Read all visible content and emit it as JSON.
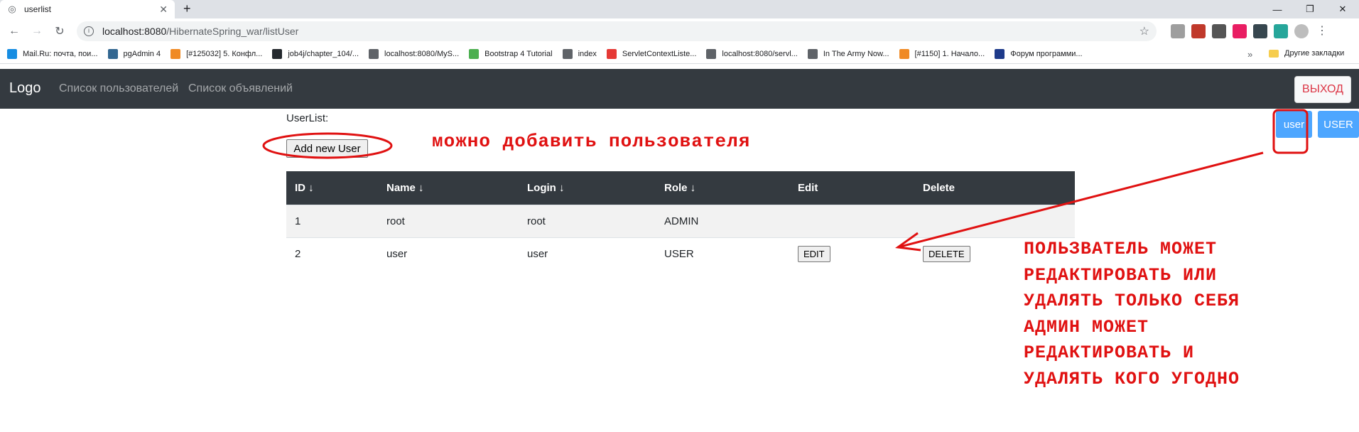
{
  "browser": {
    "tab_title": "userlist",
    "url_host": "localhost:8080",
    "url_path": "/HibernateSpring_war/listUser",
    "bookmarks": [
      {
        "label": "Mail.Ru: почта, пои...",
        "color": "#168de2"
      },
      {
        "label": "pgAdmin 4",
        "color": "#336791"
      },
      {
        "label": "[#125032] 5. Конфл...",
        "color": "#f08a24"
      },
      {
        "label": "job4j/chapter_104/...",
        "color": "#24292e"
      },
      {
        "label": "localhost:8080/MyS...",
        "color": "#5f6368"
      },
      {
        "label": "Bootstrap 4 Tutorial",
        "color": "#4caf50"
      },
      {
        "label": "index",
        "color": "#5f6368"
      },
      {
        "label": "ServletContextListe...",
        "color": "#e53935"
      },
      {
        "label": "localhost:8080/servl...",
        "color": "#5f6368"
      },
      {
        "label": "In The Army Now...",
        "color": "#5f6368"
      },
      {
        "label": "[#1150] 1. Начало...",
        "color": "#f08a24"
      },
      {
        "label": "Форум программи...",
        "color": "#1e3a8a"
      }
    ],
    "bookmarks_more": "»",
    "other_bookmarks": "Другие закладки"
  },
  "navbar": {
    "brand": "Logo",
    "links": [
      "Список пользователей",
      "Список объявлений"
    ],
    "logout_label": "ВЫХОД"
  },
  "user_badges": [
    "user",
    "USER"
  ],
  "page": {
    "heading": "UserList:",
    "add_button": "Add new User"
  },
  "table": {
    "headers": [
      "ID ↓",
      "Name ↓",
      "Login ↓",
      "Role ↓",
      "Edit",
      "Delete"
    ],
    "rows": [
      {
        "id": "1",
        "name": "root",
        "login": "root",
        "role": "ADMIN",
        "edit": "",
        "delete": ""
      },
      {
        "id": "2",
        "name": "user",
        "login": "user",
        "role": "USER",
        "edit": "EDIT",
        "delete": "DELETE"
      }
    ]
  },
  "annotations": {
    "top_note": "можно добавить пользователя",
    "right_note": [
      "ПОЛЬЗВАТЕЛЬ МОЖЕТ",
      "РЕДАКТИРОВАТЬ ИЛИ",
      "УДАЛЯТЬ ТОЛЬКО СЕБЯ",
      "АДМИН МОЖЕТ",
      "РЕДАКТИРОВАТЬ И",
      "УДАЛЯТЬ КОГО УГОДНО"
    ],
    "color": "#e01111"
  },
  "colors": {
    "navbar_bg": "#343a40",
    "badge_blue": "#4da6ff",
    "logout_red": "#dc3545"
  }
}
